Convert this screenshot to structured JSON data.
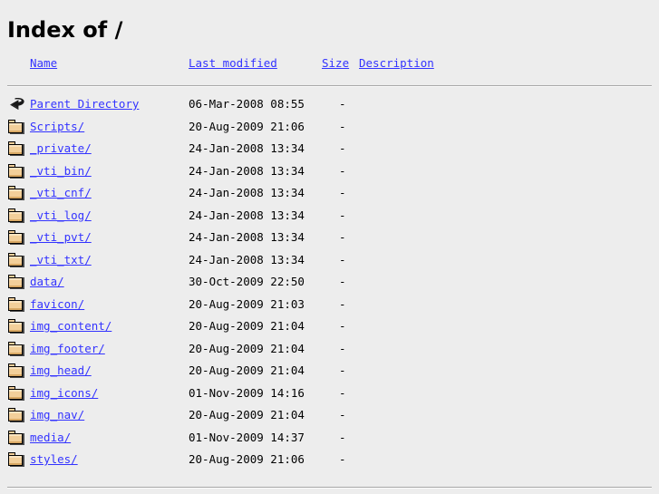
{
  "page": {
    "title": "Index of /",
    "background_color": "#ededed",
    "link_color": "#3333ff",
    "text_color": "#000000",
    "rule_color": "#a8a8a8"
  },
  "columns": {
    "name": "Name",
    "last_modified": "Last modified",
    "size": "Size",
    "description": "Description"
  },
  "entries": [
    {
      "icon": "back-icon",
      "name": "Parent Directory",
      "last_modified": "06-Mar-2008 08:55",
      "size": "-",
      "description": ""
    },
    {
      "icon": "folder-icon",
      "name": "Scripts/",
      "last_modified": "20-Aug-2009 21:06",
      "size": "-",
      "description": ""
    },
    {
      "icon": "folder-icon",
      "name": "_private/",
      "last_modified": "24-Jan-2008 13:34",
      "size": "-",
      "description": ""
    },
    {
      "icon": "folder-icon",
      "name": "_vti_bin/",
      "last_modified": "24-Jan-2008 13:34",
      "size": "-",
      "description": ""
    },
    {
      "icon": "folder-icon",
      "name": "_vti_cnf/",
      "last_modified": "24-Jan-2008 13:34",
      "size": "-",
      "description": ""
    },
    {
      "icon": "folder-icon",
      "name": "_vti_log/",
      "last_modified": "24-Jan-2008 13:34",
      "size": "-",
      "description": ""
    },
    {
      "icon": "folder-icon",
      "name": "_vti_pvt/",
      "last_modified": "24-Jan-2008 13:34",
      "size": "-",
      "description": ""
    },
    {
      "icon": "folder-icon",
      "name": "_vti_txt/",
      "last_modified": "24-Jan-2008 13:34",
      "size": "-",
      "description": ""
    },
    {
      "icon": "folder-icon",
      "name": "data/",
      "last_modified": "30-Oct-2009 22:50",
      "size": "-",
      "description": ""
    },
    {
      "icon": "folder-icon",
      "name": "favicon/",
      "last_modified": "20-Aug-2009 21:03",
      "size": "-",
      "description": ""
    },
    {
      "icon": "folder-icon",
      "name": "img_content/",
      "last_modified": "20-Aug-2009 21:04",
      "size": "-",
      "description": ""
    },
    {
      "icon": "folder-icon",
      "name": "img_footer/",
      "last_modified": "20-Aug-2009 21:04",
      "size": "-",
      "description": ""
    },
    {
      "icon": "folder-icon",
      "name": "img_head/",
      "last_modified": "20-Aug-2009 21:04",
      "size": "-",
      "description": ""
    },
    {
      "icon": "folder-icon",
      "name": "img_icons/",
      "last_modified": "01-Nov-2009 14:16",
      "size": "-",
      "description": ""
    },
    {
      "icon": "folder-icon",
      "name": "img_nav/",
      "last_modified": "20-Aug-2009 21:04",
      "size": "-",
      "description": ""
    },
    {
      "icon": "folder-icon",
      "name": "media/",
      "last_modified": "01-Nov-2009 14:37",
      "size": "-",
      "description": ""
    },
    {
      "icon": "folder-icon",
      "name": "styles/",
      "last_modified": "20-Aug-2009 21:06",
      "size": "-",
      "description": ""
    }
  ]
}
